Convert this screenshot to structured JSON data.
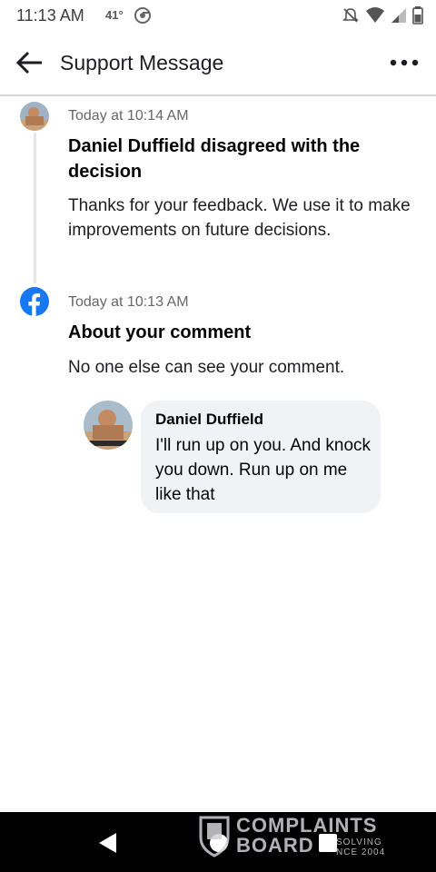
{
  "status_bar": {
    "time": "11:13 AM",
    "temperature": "41°",
    "icons": [
      "chrome-icon",
      "notifications-off-icon",
      "wifi-icon",
      "signal-icon",
      "battery-icon"
    ]
  },
  "app_bar": {
    "title": "Support Message",
    "back_icon": "arrow-left-icon",
    "more_icon": "more-horizontal-icon"
  },
  "entries": [
    {
      "time": "Today at 10:14 AM",
      "title": "Daniel Duffield disagreed with the decision",
      "body": "Thanks for your feedback. We use it to make improvements on future decisions."
    },
    {
      "time": "Today at 10:13 AM",
      "title": "About your comment",
      "body": "No one else can see your comment."
    }
  ],
  "comment": {
    "author": "Daniel Duffield",
    "text": "I'll run up on you. And knock you down. Run up on me like that"
  },
  "watermark": {
    "line1": "COMPLAINTS",
    "line2": "BOARD",
    "small1": "SOLVING",
    "small2": "NCE 2004"
  },
  "colors": {
    "facebook_blue": "#1877f2",
    "bubble": "#f0f2f5",
    "secondary_text": "#65676b"
  }
}
